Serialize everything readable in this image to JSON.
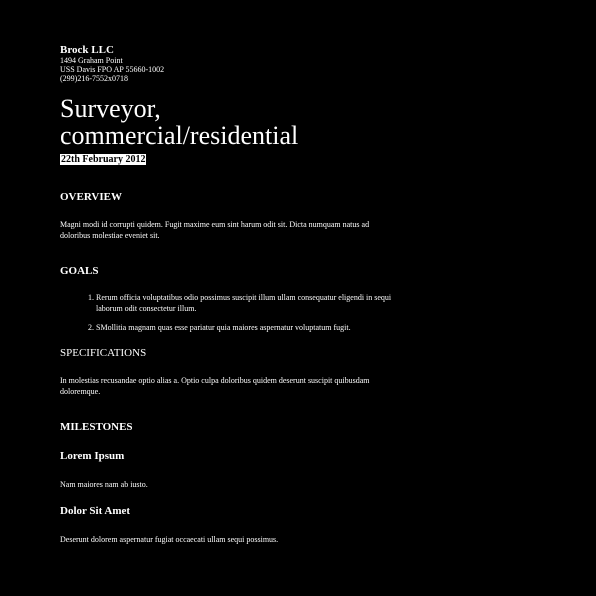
{
  "header": {
    "company": "Brock LLC",
    "address": [
      "1494 Graham Point",
      "USS Davis FPO AP 55660-1002",
      "(299)216-7552x0718"
    ]
  },
  "title_lines": [
    "Surveyor,",
    "commercial/residential"
  ],
  "date": "22th February 2012",
  "overview": {
    "heading": "OVERVIEW",
    "text": "Magni modi id corrupti quidem. Fugit maxime eum sint harum odit sit. Dicta numquam natus ad doloribus molestiae eveniet sit."
  },
  "goals": {
    "heading": "GOALS",
    "items": [
      "Rerum officia voluptatibus odio possimus suscipit illum ullam consequatur eligendi in sequi laborum odit consectetur illum.",
      "SMollitia magnam quas esse pariatur quia maiores aspernatur voluptatum fugit."
    ]
  },
  "specifications": {
    "heading": "SPECIFICATIONS",
    "text": "In molestias recusandae optio alias a. Optio culpa doloribus quidem deserunt suscipit quibusdam doloremque."
  },
  "milestones": {
    "heading": "MILESTONES",
    "items": [
      {
        "title": "Lorem Ipsum",
        "text": "Nam maiores nam ab iusto."
      },
      {
        "title": "Dolor Sit Amet",
        "text": "Deserunt dolorem aspernatur fugiat occaecati ullam sequi possimus."
      }
    ]
  }
}
